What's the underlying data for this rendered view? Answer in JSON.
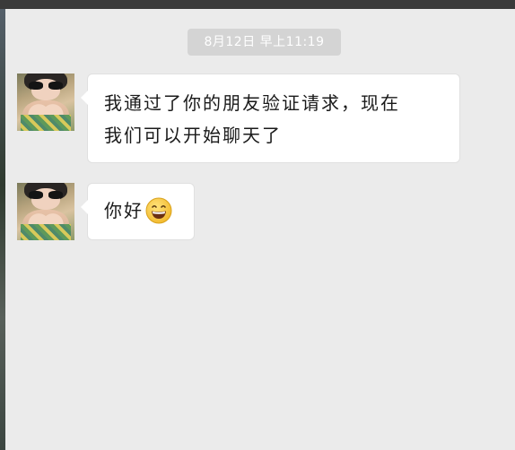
{
  "chat": {
    "timestamp": "8月12日  早上11:19",
    "messages": [
      {
        "sender": "contact",
        "lines": [
          "我通过了你的朋友验证请求，现在",
          "我们可以开始聊天了"
        ]
      },
      {
        "sender": "contact",
        "text": "你好",
        "emoji": "grinning-face-icon"
      }
    ]
  },
  "colors": {
    "chat_background": "#ebebeb",
    "bubble": "#ffffff",
    "timestamp_pill": "#d4d4d4",
    "emoji_face": "#f9c93a"
  }
}
